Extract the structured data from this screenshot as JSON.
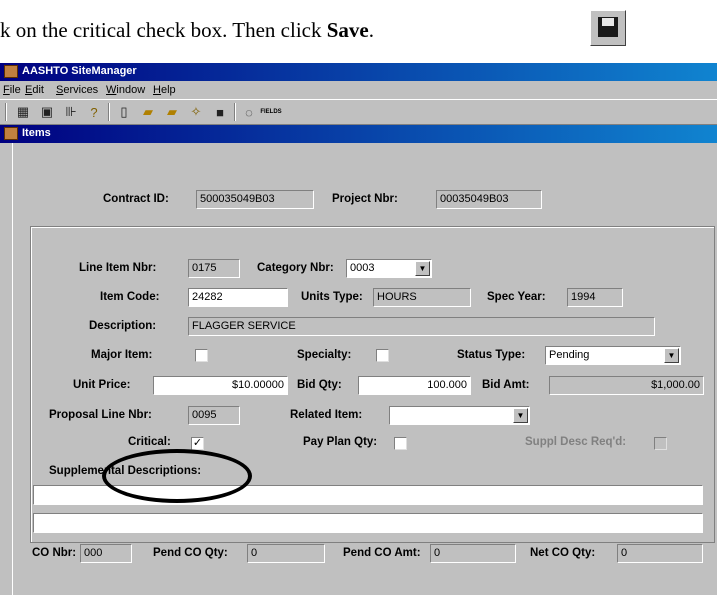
{
  "instruction": {
    "text_prefix": "k on the critical check box.  Then click ",
    "bold": "Save",
    "suffix": "."
  },
  "app": {
    "title": "AASHTO SiteManager"
  },
  "menu": [
    "File",
    "Edit",
    "Services",
    "Window",
    "Help"
  ],
  "toolbar": {
    "icons": [
      "grid-icon",
      "monitor-icon",
      "filter-icon",
      "help-icon",
      "new-icon",
      "open-icon",
      "open-alt-icon",
      "wizard-icon",
      "save-icon",
      "comment-icon",
      "fields-icon"
    ],
    "fields_label": "FIELDS"
  },
  "child_window": {
    "title": "Items"
  },
  "header": {
    "contract_id_label": "Contract ID:",
    "contract_id": "500035049B03",
    "project_nbr_label": "Project Nbr:",
    "project_nbr": "00035049B03"
  },
  "form": {
    "line_item_nbr_label": "Line Item Nbr:",
    "line_item_nbr": "0175",
    "category_nbr_label": "Category Nbr:",
    "category_nbr": "0003",
    "item_code_label": "Item Code:",
    "item_code": "24282",
    "units_type_label": "Units Type:",
    "units_type": "HOURS",
    "spec_year_label": "Spec Year:",
    "spec_year": "1994",
    "description_label": "Description:",
    "description": "FLAGGER SERVICE",
    "major_item_label": "Major Item:",
    "specialty_label": "Specialty:",
    "status_type_label": "Status Type:",
    "status_type": "Pending",
    "unit_price_label": "Unit Price:",
    "unit_price": "$10.00000",
    "bid_qty_label": "Bid Qty:",
    "bid_qty": "100.000",
    "bid_amt_label": "Bid Amt:",
    "bid_amt": "$1,000.00",
    "proposal_line_nbr_label": "Proposal Line Nbr:",
    "proposal_line_nbr": "0095",
    "related_item_label": "Related Item:",
    "related_item": "",
    "critical_label": "Critical:",
    "critical_checked": "✓",
    "pay_plan_qty_label": "Pay Plan Qty:",
    "suppl_desc_label": "Suppl Desc Req'd:",
    "supplemental_label": "Supplemental Descriptions:",
    "co_nbr_label": "CO Nbr:",
    "co_nbr": "000",
    "pend_co_qty_label": "Pend CO Qty:",
    "pend_co_qty": "0",
    "pend_co_amt_label": "Pend CO Amt:",
    "pend_co_amt": "0",
    "net_co_qty_label": "Net CO Qty:",
    "net_co_qty": "0"
  }
}
